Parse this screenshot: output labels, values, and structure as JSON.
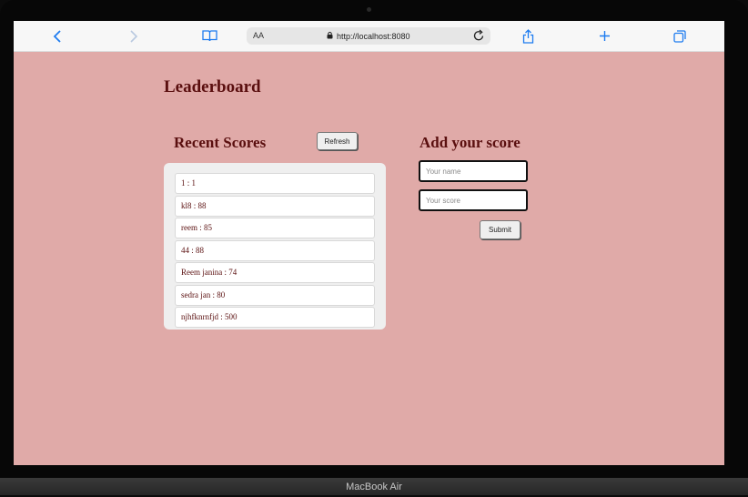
{
  "browser": {
    "reader_label": "AA",
    "url": "http://localhost:8080"
  },
  "device": {
    "label": "MacBook Air"
  },
  "page": {
    "title": "Leaderboard",
    "recent": {
      "heading": "Recent Scores",
      "refresh_label": "Refresh",
      "scores": [
        "1 : 1",
        "kl8 : 88",
        "reem : 85",
        "44 : 88",
        "Reem janina : 74",
        "sedra jan : 80",
        "njhfknrnfjd : 500"
      ]
    },
    "add": {
      "heading": "Add your score",
      "name_placeholder": "Your name",
      "score_placeholder": "Your score",
      "submit_label": "Submit"
    }
  },
  "colors": {
    "page_bg": "#e0aaa8",
    "heading_text": "#5a0f0f",
    "accent": "#1e7cf0"
  }
}
